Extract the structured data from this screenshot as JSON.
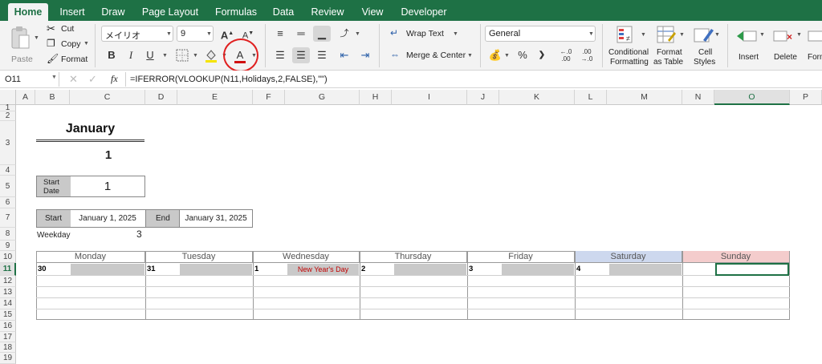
{
  "tabs": [
    "Home",
    "Insert",
    "Draw",
    "Page Layout",
    "Formulas",
    "Data",
    "Review",
    "View",
    "Developer"
  ],
  "ribbon": {
    "paste": "Paste",
    "cut": "Cut",
    "copy": "Copy",
    "format": "Format",
    "font_name": "メイリオ",
    "font_size": "9",
    "bold": "B",
    "italic": "I",
    "underline": "U",
    "font_color_glyph": "A",
    "wrap_text": "Wrap Text",
    "merge_center": "Merge & Center",
    "number_format": "General",
    "percent": "%",
    "comma": "❯",
    "inc_decimal": "←.0\n.00",
    "dec_decimal": ".00\n→.0",
    "conditional_formatting": [
      "Conditional",
      "Formatting"
    ],
    "format_as_table": [
      "Format",
      "as Table"
    ],
    "cell_styles": [
      "Cell",
      "Styles"
    ],
    "insert": "Insert",
    "delete": "Delete",
    "format_cut": "Form",
    "highlight_color": "#e02020",
    "accent": "#1e7145"
  },
  "formula_bar": {
    "cell_ref": "O11",
    "fx": "fx",
    "formula": "=IFERROR(VLOOKUP(N11,Holidays,2,FALSE),\"\")"
  },
  "columns": [
    "A",
    "B",
    "C",
    "D",
    "E",
    "F",
    "G",
    "H",
    "I",
    "J",
    "K",
    "L",
    "M",
    "N",
    "O",
    "P"
  ],
  "rows": [
    "1",
    "2",
    "3",
    "4",
    "5",
    "6",
    "7",
    "8",
    "9",
    "10",
    "11",
    "12",
    "13",
    "14",
    "15",
    "16",
    "17",
    "18",
    "19"
  ],
  "sheet": {
    "month": "January",
    "month_number": "1",
    "start_date_label": "Start\nDate",
    "start_date_value": "1",
    "start_label": "Start",
    "start_value": "January 1, 2025",
    "end_label": "End",
    "end_value": "January 31, 2025",
    "weekday_label": "Weekday",
    "weekday_value": "3",
    "weekdays": [
      "Monday",
      "Tuesday",
      "Wednesday",
      "Thursday",
      "Friday",
      "Saturday",
      "Sunday"
    ],
    "week1_days": [
      "30",
      "31",
      "1",
      "2",
      "3",
      "4",
      ""
    ],
    "holiday": "New Year's Day",
    "saturday_color": "#cdd8ee",
    "sunday_color": "#f4cccc",
    "holiday_color": "#c00000"
  }
}
